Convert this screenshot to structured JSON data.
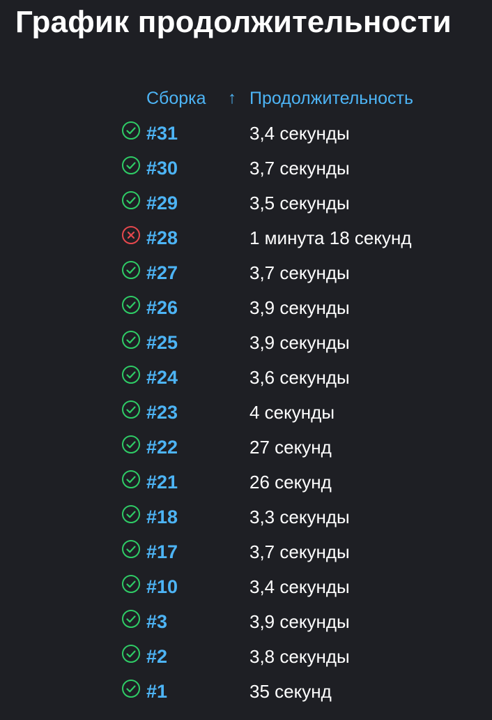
{
  "page": {
    "title": "График продолжительности"
  },
  "table": {
    "columns": {
      "build": "Сборка",
      "sort_indicator": "↑",
      "duration": "Продолжительность"
    },
    "rows": [
      {
        "status": "success",
        "status_icon": "check-circle-icon",
        "build": "#31",
        "duration": "3,4 секунды"
      },
      {
        "status": "success",
        "status_icon": "check-circle-icon",
        "build": "#30",
        "duration": "3,7 секунды"
      },
      {
        "status": "success",
        "status_icon": "check-circle-icon",
        "build": "#29",
        "duration": "3,5 секунды"
      },
      {
        "status": "failure",
        "status_icon": "error-circle-icon",
        "build": "#28",
        "duration": "1 минута 18 секунд"
      },
      {
        "status": "success",
        "status_icon": "check-circle-icon",
        "build": "#27",
        "duration": "3,7 секунды"
      },
      {
        "status": "success",
        "status_icon": "check-circle-icon",
        "build": "#26",
        "duration": "3,9 секунды"
      },
      {
        "status": "success",
        "status_icon": "check-circle-icon",
        "build": "#25",
        "duration": "3,9 секунды"
      },
      {
        "status": "success",
        "status_icon": "check-circle-icon",
        "build": "#24",
        "duration": "3,6 секунды"
      },
      {
        "status": "success",
        "status_icon": "check-circle-icon",
        "build": "#23",
        "duration": "4 секунды"
      },
      {
        "status": "success",
        "status_icon": "check-circle-icon",
        "build": "#22",
        "duration": "27 секунд"
      },
      {
        "status": "success",
        "status_icon": "check-circle-icon",
        "build": "#21",
        "duration": "26 секунд"
      },
      {
        "status": "success",
        "status_icon": "check-circle-icon",
        "build": "#18",
        "duration": "3,3 секунды"
      },
      {
        "status": "success",
        "status_icon": "check-circle-icon",
        "build": "#17",
        "duration": "3,7 секунды"
      },
      {
        "status": "success",
        "status_icon": "check-circle-icon",
        "build": "#10",
        "duration": "3,4 секунды"
      },
      {
        "status": "success",
        "status_icon": "check-circle-icon",
        "build": "#3",
        "duration": "3,9 секунды"
      },
      {
        "status": "success",
        "status_icon": "check-circle-icon",
        "build": "#2",
        "duration": "3,8 секунды"
      },
      {
        "status": "success",
        "status_icon": "check-circle-icon",
        "build": "#1",
        "duration": "35 секунд"
      }
    ]
  },
  "colors": {
    "background": "#1e1f24",
    "link": "#4db4f5",
    "success": "#2fcc66",
    "failure": "#e5484d",
    "text": "#ffffff"
  }
}
